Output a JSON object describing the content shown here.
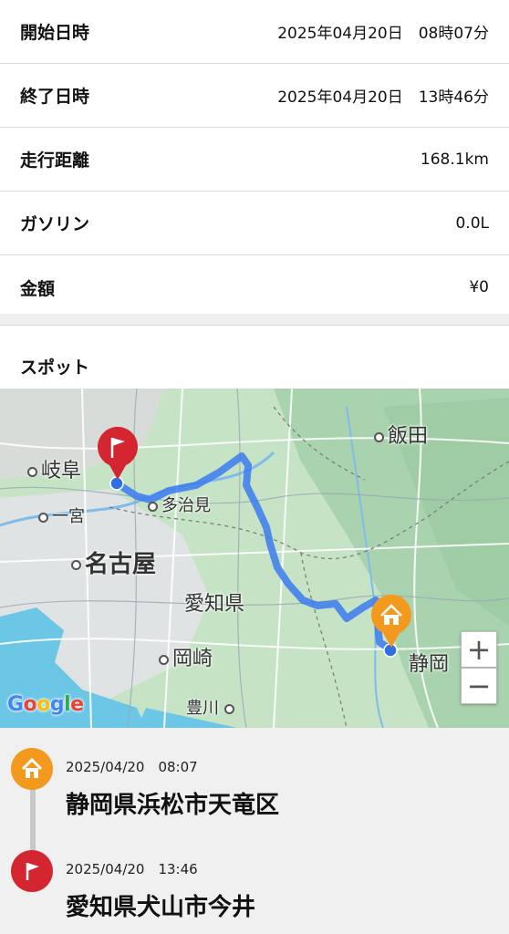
{
  "summary": {
    "rows": [
      {
        "label": "開始日時",
        "value": "2025年04月20日　08時07分"
      },
      {
        "label": "終了日時",
        "value": "2025年04月20日　13時46分"
      },
      {
        "label": "走行距離",
        "value": "168.1km"
      },
      {
        "label": "ガソリン",
        "value": "0.0L"
      },
      {
        "label": "金額",
        "value": "¥0"
      }
    ]
  },
  "spot": {
    "title": "スポット"
  },
  "map": {
    "labels": {
      "iida": "飯田",
      "gifu": "岐阜",
      "tajimi": "多治見",
      "ichinomiya": "一宮",
      "nagoya": "名古屋",
      "aichi": "愛知県",
      "okazaki": "岡崎",
      "shizuoka": "静岡",
      "toyokawa": "豊川"
    },
    "attribution": "Google",
    "zoom_in": "+",
    "zoom_out": "−",
    "colors": {
      "route": "#3b7bf0",
      "start_pin": "#f39a1e",
      "end_pin": "#d32630"
    }
  },
  "timeline": {
    "start": {
      "time": "2025/04/20　08:07",
      "place": "静岡県浜松市天竜区"
    },
    "end": {
      "time": "2025/04/20　13:46",
      "place": "愛知県犬山市今井"
    }
  }
}
